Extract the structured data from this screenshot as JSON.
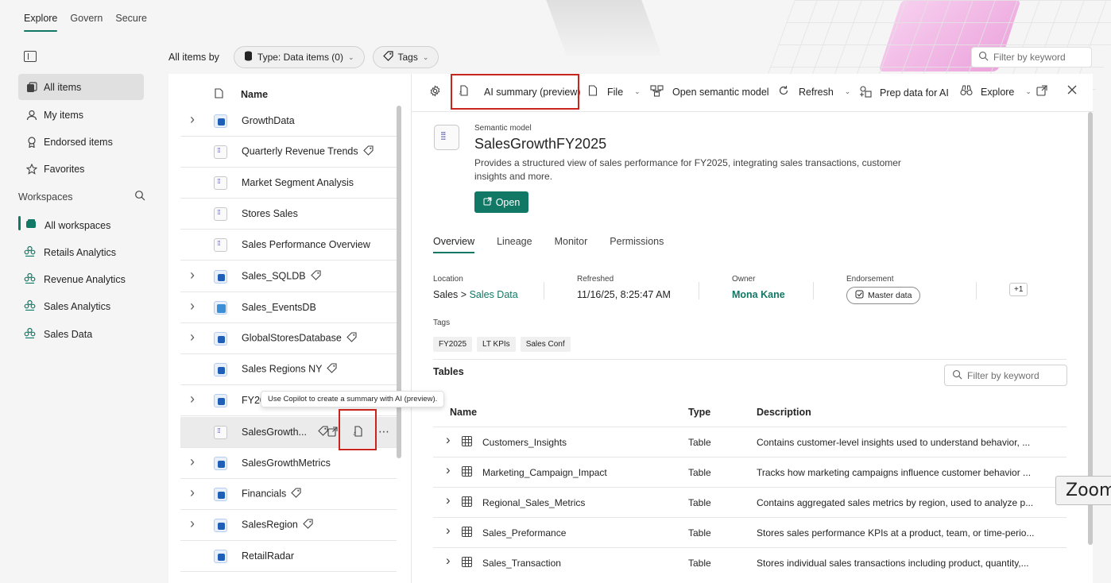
{
  "top_tabs": [
    "Explore",
    "Govern",
    "Secure"
  ],
  "left_nav": {
    "items": [
      "All items",
      "My items",
      "Endorsed items",
      "Favorites"
    ],
    "workspaces_label": "Workspaces",
    "workspaces": [
      "All workspaces",
      "Retails Analytics",
      "Revenue Analytics",
      "Sales Analytics",
      "Sales Data"
    ]
  },
  "filter_bar": {
    "label": "All items by",
    "type_filter": "Type: Data items (0)",
    "tags_filter": "Tags",
    "search_placeholder": "Filter by keyword"
  },
  "list": {
    "header": "Name",
    "rows": [
      {
        "name": "GrowthData",
        "icon": "database-icon",
        "expandable": true,
        "tag": false
      },
      {
        "name": "Quarterly Revenue Trends",
        "icon": "semantic-model-icon",
        "expandable": false,
        "tag": true
      },
      {
        "name": "Market Segment Analysis",
        "icon": "semantic-model-icon",
        "expandable": false,
        "tag": false
      },
      {
        "name": "Stores Sales",
        "icon": "semantic-model-icon",
        "expandable": false,
        "tag": false
      },
      {
        "name": "Sales Performance Overview",
        "icon": "semantic-model-icon",
        "expandable": false,
        "tag": false
      },
      {
        "name": "Sales_SQLDB",
        "icon": "sql-database-icon",
        "expandable": true,
        "tag": true
      },
      {
        "name": "Sales_EventsDB",
        "icon": "eventhouse-icon",
        "expandable": true,
        "tag": false
      },
      {
        "name": "GlobalStoresDatabase",
        "icon": "database-icon",
        "expandable": true,
        "tag": true
      },
      {
        "name": "Sales Regions NY",
        "icon": "database-icon",
        "expandable": false,
        "tag": true
      },
      {
        "name": "FY20",
        "icon": "database-icon",
        "expandable": true,
        "tag": false
      },
      {
        "name": "SalesGrowth...",
        "icon": "semantic-model-icon",
        "expandable": false,
        "tag": true
      },
      {
        "name": "SalesGrowthMetrics",
        "icon": "database-icon",
        "expandable": true,
        "tag": false
      },
      {
        "name": "Financials",
        "icon": "database-icon",
        "expandable": true,
        "tag": true
      },
      {
        "name": "SalesRegion",
        "icon": "database-icon",
        "expandable": true,
        "tag": true
      },
      {
        "name": "RetailRadar",
        "icon": "database-icon",
        "expandable": false,
        "tag": false
      }
    ],
    "tooltip": "Use Copilot to create a summary with AI (preview)."
  },
  "toolbar": {
    "ai_summary": "AI summary (preview)",
    "file": "File",
    "open_semantic_model": "Open semantic model",
    "refresh": "Refresh",
    "prep_data": "Prep data for AI",
    "explore": "Explore"
  },
  "detail": {
    "kind": "Semantic model",
    "title": "SalesGrowthFY2025",
    "description": "Provides a structured view of sales performance for FY2025, integrating sales transactions, customer insights and more.",
    "open_label": "Open",
    "tabs": [
      "Overview",
      "Lineage",
      "Monitor",
      "Permissions"
    ],
    "location_label": "Location",
    "location_root": "Sales",
    "location_sep": ">",
    "location_child": "Sales Data",
    "refreshed_label": "Refreshed",
    "refreshed_value": "11/16/25, 8:25:47 AM",
    "owner_label": "Owner",
    "owner_value": "Mona Kane",
    "endorsement_label": "Endorsement",
    "endorsement_value": "Master data",
    "more_count": "+1",
    "tags_label": "Tags",
    "tags": [
      "FY2025",
      "LT KPIs",
      "Sales Conf"
    ],
    "tables_label": "Tables",
    "tables_search_placeholder": "Filter by keyword",
    "table_columns": [
      "Name",
      "Type",
      "Description"
    ],
    "tables": [
      {
        "name": "Customers_Insights",
        "type": "Table",
        "description": "Contains customer-level insights used to understand behavior, ..."
      },
      {
        "name": "Marketing_Campaign_Impact",
        "type": "Table",
        "description": "Tracks how marketing campaigns influence customer behavior ..."
      },
      {
        "name": "Regional_Sales_Metrics",
        "type": "Table",
        "description": "Contains aggregated sales metrics by region, used to analyze p..."
      },
      {
        "name": "Sales_Preformance",
        "type": "Table",
        "description": "Stores sales performance KPIs at a product, team, or time-perio..."
      },
      {
        "name": "Sales_Transaction",
        "type": "Table",
        "description": "Stores individual sales transactions including product, quantity,..."
      }
    ]
  },
  "zoom_label": "Zoom",
  "colors": {
    "accent": "#117865",
    "highlight": "#c8251e"
  }
}
